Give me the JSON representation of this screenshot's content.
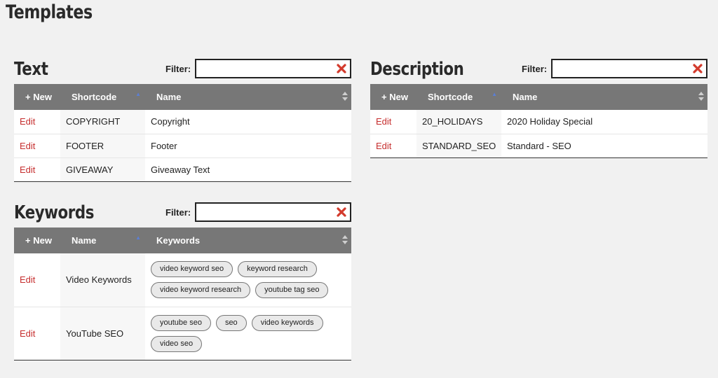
{
  "page": {
    "title": "Templates"
  },
  "filter_label": "Filter:",
  "new_label": "+ New",
  "edit_label": "Edit",
  "text_panel": {
    "title": "Text",
    "filter_value": "",
    "columns": [
      "Shortcode",
      "Name"
    ],
    "rows": [
      {
        "shortcode": "COPYRIGHT",
        "name": "Copyright"
      },
      {
        "shortcode": "FOOTER",
        "name": "Footer"
      },
      {
        "shortcode": "GIVEAWAY",
        "name": "Giveaway Text"
      }
    ]
  },
  "description_panel": {
    "title": "Description",
    "filter_value": "",
    "columns": [
      "Shortcode",
      "Name"
    ],
    "rows": [
      {
        "shortcode": "20_HOLIDAYS",
        "name": "2020 Holiday Special"
      },
      {
        "shortcode": "STANDARD_SEO",
        "name": "Standard - SEO"
      }
    ]
  },
  "keywords_panel": {
    "title": "Keywords",
    "filter_value": "",
    "columns": [
      "Name",
      "Keywords"
    ],
    "rows": [
      {
        "name": "Video Keywords",
        "keywords": [
          "video keyword seo",
          "keyword research",
          "video keyword research",
          "youtube tag seo"
        ]
      },
      {
        "name": "YouTube SEO",
        "keywords": [
          "youtube seo",
          "seo",
          "video keywords",
          "video seo"
        ]
      }
    ]
  },
  "colors": {
    "header_bg": "#777777",
    "edit_link": "#c62e2e",
    "clear_icon": "#d33a2c",
    "sort_asc": "#5b7fd6"
  }
}
